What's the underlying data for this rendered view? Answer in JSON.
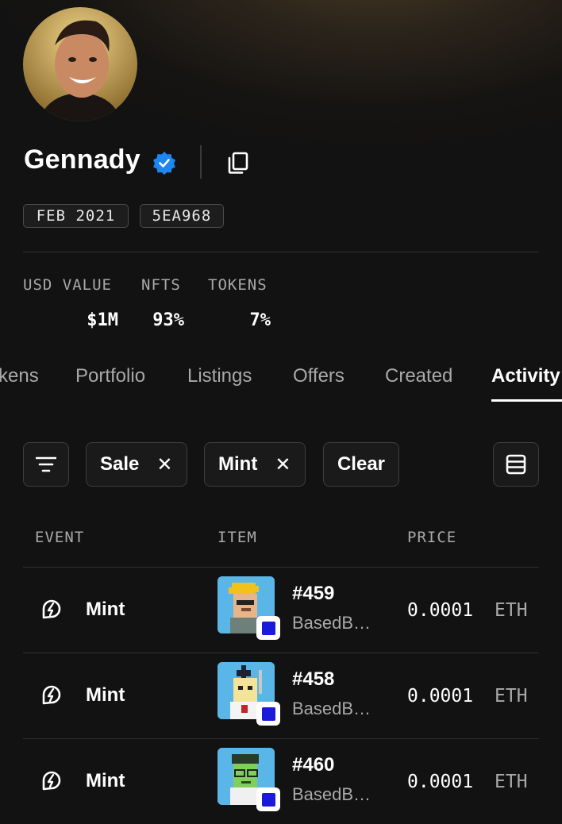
{
  "profile": {
    "name": "Gennady",
    "joined": "FEB 2021",
    "address": "5EA968"
  },
  "stats": {
    "usd_value": {
      "label": "USD VALUE",
      "value": "$1M"
    },
    "nfts": {
      "label": "NFTS",
      "value": "93%"
    },
    "tokens": {
      "label": "TOKENS",
      "value": "7%"
    }
  },
  "tabs": [
    {
      "label": "kens"
    },
    {
      "label": "Portfolio"
    },
    {
      "label": "Listings"
    },
    {
      "label": "Offers"
    },
    {
      "label": "Created"
    },
    {
      "label": "Activity",
      "active": true
    }
  ],
  "filters": {
    "chips": [
      {
        "label": "Sale",
        "close": "✕"
      },
      {
        "label": "Mint",
        "close": "✕"
      }
    ],
    "clear_label": "Clear"
  },
  "table": {
    "headers": {
      "event": "EVENT",
      "item": "ITEM",
      "price": "PRICE"
    },
    "rows": [
      {
        "event": "Mint",
        "item_id": "#459",
        "collection": "BasedB…",
        "price": "0.0001",
        "currency": "ETH",
        "thumb_icon": "punk-yellow-hair"
      },
      {
        "event": "Mint",
        "item_id": "#458",
        "collection": "BasedB…",
        "price": "0.0001",
        "currency": "ETH",
        "thumb_icon": "punk-mohawk"
      },
      {
        "event": "Mint",
        "item_id": "#460",
        "collection": "BasedB…",
        "price": "0.0001",
        "currency": "ETH",
        "thumb_icon": "punk-zombie"
      }
    ]
  },
  "colors": {
    "background": "#121212",
    "verified_badge": "#1e86f0",
    "thumbnail_bg": "#5ab6e6",
    "chain_badge": "#1a1ad8"
  }
}
